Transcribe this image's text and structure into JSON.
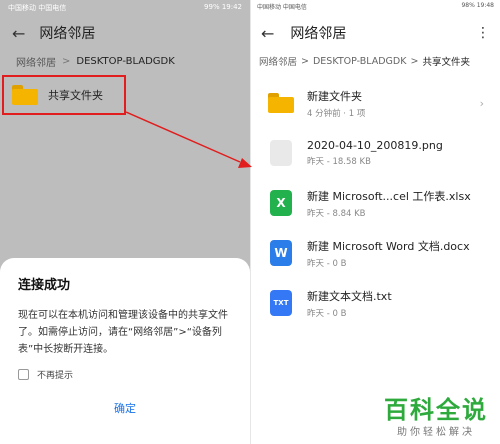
{
  "left": {
    "status": {
      "left": "中国移动 中国电信",
      "right": "99% 19:42"
    },
    "title": "网络邻居",
    "breadcrumb": {
      "root": "网络邻居",
      "sep": ">",
      "current": "DESKTOP-BLADGDK"
    },
    "folder": {
      "name": "共享文件夹"
    },
    "dialog": {
      "title": "连接成功",
      "body": "现在可以在本机访问和管理该设备中的共享文件了。如需停止访问，请在“网络邻居”>“设备列表”中长按断开连接。",
      "checkbox_label": "不再提示",
      "confirm": "确定"
    }
  },
  "right": {
    "status": {
      "left": "中国移动 中国电信",
      "right": "98% 19:48"
    },
    "title": "网络邻居",
    "breadcrumb": {
      "root": "网络邻居",
      "sep1": ">",
      "mid": "DESKTOP-BLADGDK",
      "sep2": ">",
      "current": "共享文件夹"
    },
    "items": [
      {
        "name": "新建文件夹",
        "meta": "4 分钟前 · 1 项",
        "icon": "folder-icon"
      },
      {
        "name": "2020-04-10_200819.png",
        "meta": "昨天 - 18.58 KB",
        "icon": "image-file-icon"
      },
      {
        "name": "新建 Microsoft...cel 工作表.xlsx",
        "meta": "昨天 - 8.84 KB",
        "icon": "excel-file-icon",
        "glyph": "X"
      },
      {
        "name": "新建 Microsoft Word 文档.docx",
        "meta": "昨天 - 0 B",
        "icon": "word-file-icon",
        "glyph": "W"
      },
      {
        "name": "新建文本文档.txt",
        "meta": "昨天 - 0 B",
        "icon": "text-file-icon",
        "glyph": "TXT"
      }
    ]
  },
  "watermark": {
    "title": "百科全说",
    "subtitle": "助你轻松解决"
  },
  "colors": {
    "highlight": "#e11d1d",
    "accent": "#1a73e8",
    "brand": "#2eaa3d"
  }
}
